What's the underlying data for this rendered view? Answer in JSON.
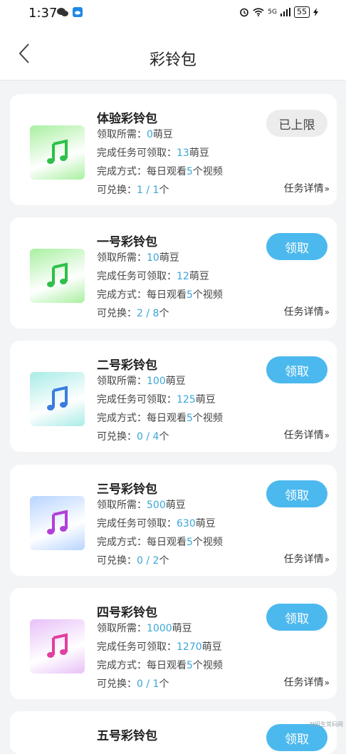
{
  "status_bar": {
    "time": "1:37",
    "battery": "55",
    "network": "5G"
  },
  "nav": {
    "title": "彩铃包"
  },
  "labels": {
    "cost_prefix": "领取所需：",
    "reward_prefix": "完成任务可领取：",
    "method_prefix": "完成方式：",
    "exchange_prefix": "可兑换：",
    "unit_beans": "萌豆",
    "unit_ge": "个",
    "method_text_pre": "每日观看",
    "method_text_post": "个视频",
    "detail": "任务详情",
    "chevron": "»"
  },
  "packages": [
    {
      "title": "体验彩铃包",
      "cost": "0",
      "reward": "13",
      "videos": "5",
      "exchange": "1 / 1",
      "button": "已上限",
      "thumb_bg": "#a8f0a0",
      "note_color": "#2ec04a"
    },
    {
      "title": "一号彩铃包",
      "cost": "10",
      "reward": "12",
      "videos": "5",
      "exchange": "2 / 8",
      "button": "领取",
      "thumb_bg": "#a8f0a0",
      "note_color": "#2ec04a"
    },
    {
      "title": "二号彩铃包",
      "cost": "100",
      "reward": "125",
      "videos": "5",
      "exchange": "0 / 4",
      "button": "领取",
      "thumb_bg": "#a8ece6",
      "note_color": "#3a7de0"
    },
    {
      "title": "三号彩铃包",
      "cost": "500",
      "reward": "630",
      "videos": "5",
      "exchange": "0 / 2",
      "button": "领取",
      "thumb_bg": "#b8d4ff",
      "note_color": "#b040d8"
    },
    {
      "title": "四号彩铃包",
      "cost": "1000",
      "reward": "1270",
      "videos": "5",
      "exchange": "0 / 1",
      "button": "领取",
      "thumb_bg": "#e8c0f8",
      "note_color": "#e040a0"
    }
  ],
  "partial_card": {
    "title": "五号彩铃包"
  },
  "watermark": "M旧生常码网"
}
